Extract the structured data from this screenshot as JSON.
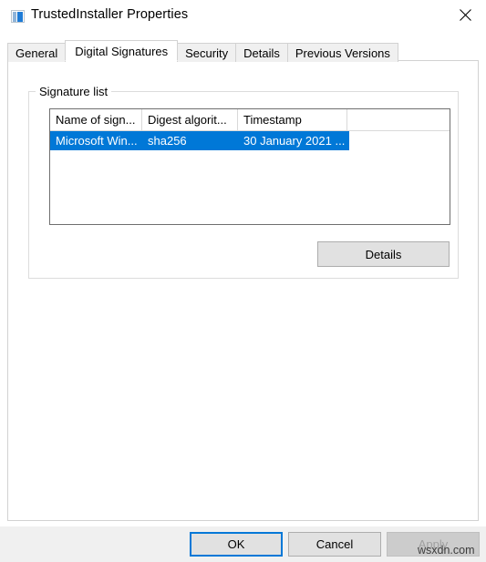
{
  "window": {
    "title": "TrustedInstaller Properties",
    "icon": "properties-window-icon",
    "close_label": "×"
  },
  "tabs": [
    {
      "label": "General",
      "selected": false
    },
    {
      "label": "Digital Signatures",
      "selected": true
    },
    {
      "label": "Security",
      "selected": false
    },
    {
      "label": "Details",
      "selected": false
    },
    {
      "label": "Previous Versions",
      "selected": false
    }
  ],
  "signature_group": {
    "legend": "Signature list",
    "list": {
      "columns": [
        "Name of sign...",
        "Digest algorit...",
        "Timestamp",
        ""
      ],
      "rows": [
        {
          "name": "Microsoft Win...",
          "digest": "sha256",
          "timestamp": "30 January 2021 ...",
          "selected": true
        }
      ]
    },
    "details_button": "Details"
  },
  "footer": {
    "ok": "OK",
    "cancel": "Cancel",
    "apply": "Apply",
    "apply_disabled": true
  },
  "watermark": "wsxdn.com",
  "colors": {
    "accent": "#0078d7",
    "dialog_bg": "#f0f0f0",
    "page_bg": "#ffffff",
    "button_face": "#e1e1e1",
    "disabled_text": "#a0a0a0"
  }
}
